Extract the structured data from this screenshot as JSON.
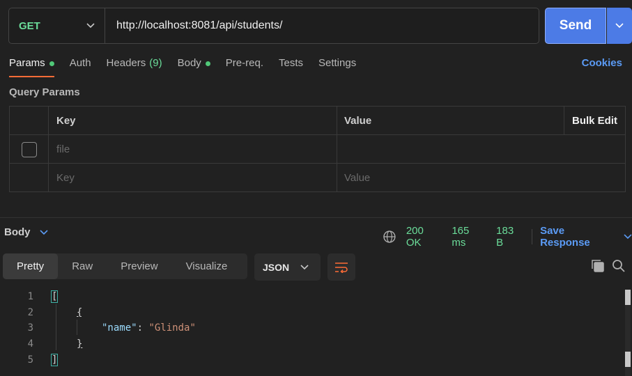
{
  "request": {
    "method": "GET",
    "url": "http://localhost:8081/api/students/",
    "send_label": "Send"
  },
  "tabs": [
    {
      "label": "Params",
      "dot": true
    },
    {
      "label": "Auth"
    },
    {
      "label": "Headers",
      "count": "(9)"
    },
    {
      "label": "Body",
      "dot": true
    },
    {
      "label": "Pre-req."
    },
    {
      "label": "Tests"
    },
    {
      "label": "Settings"
    }
  ],
  "cookies_label": "Cookies",
  "query_params": {
    "title": "Query Params",
    "headers": {
      "key": "Key",
      "value": "Value",
      "bulk": "Bulk Edit"
    },
    "row1_key_placeholder": "file",
    "row2_key_placeholder": "Key",
    "row2_value_placeholder": "Value"
  },
  "response": {
    "body_label": "Body",
    "status": "200 OK",
    "time": "165 ms",
    "size": "183 B",
    "save_label": "Save Response",
    "view_tabs": [
      "Pretty",
      "Raw",
      "Preview",
      "Visualize"
    ],
    "format": "JSON",
    "code_lines": [
      "1",
      "2",
      "3",
      "4",
      "5"
    ],
    "json_key": "\"name\"",
    "json_value": "\"Glinda\""
  },
  "colors": {
    "accent": "#ff6c37",
    "send": "#4c7be6",
    "status_ok": "#6bdd9a",
    "link": "#5b9bf5"
  }
}
